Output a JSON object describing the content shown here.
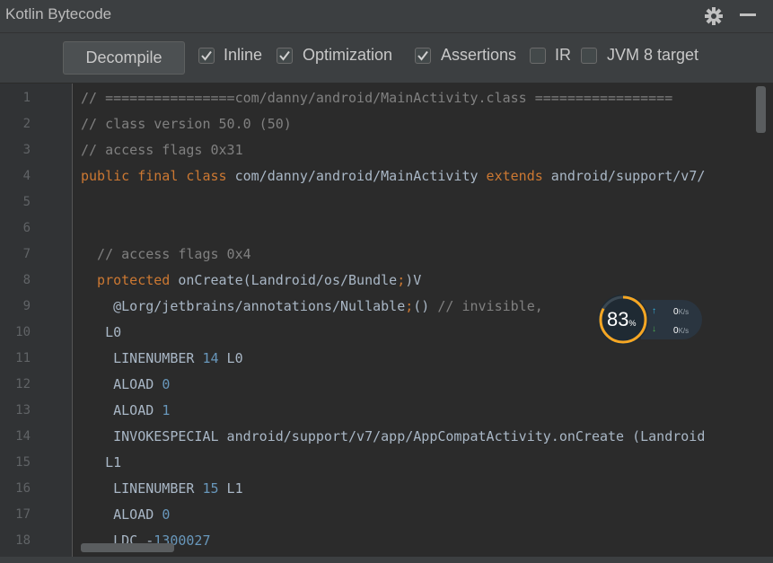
{
  "window": {
    "title": "Kotlin Bytecode"
  },
  "toolbar": {
    "decompile_label": "Decompile",
    "options": [
      {
        "label": "Inline",
        "checked": true
      },
      {
        "label": "Optimization",
        "checked": true
      },
      {
        "label": "Assertions",
        "checked": true
      },
      {
        "label": "IR",
        "checked": false
      },
      {
        "label": "JVM 8 target",
        "checked": false
      }
    ]
  },
  "editor": {
    "lines": [
      [
        {
          "t": "// ================com/danny/android/MainActivity.class =================",
          "c": "c"
        }
      ],
      [
        {
          "t": "// class version 50.0 (50)",
          "c": "c"
        }
      ],
      [
        {
          "t": "// access flags 0x31",
          "c": "c"
        }
      ],
      [
        {
          "t": "public final class",
          "c": "k"
        },
        {
          "t": " com/danny/android/MainActivity ",
          "c": ""
        },
        {
          "t": "extends",
          "c": "k"
        },
        {
          "t": " android/support/v7/",
          "c": ""
        }
      ],
      [],
      [],
      [
        {
          "t": "  // access flags 0x4",
          "c": "c"
        }
      ],
      [
        {
          "t": "  protected",
          "c": "k"
        },
        {
          "t": " onCreate(Landroid/os/Bundle",
          "c": ""
        },
        {
          "t": ";",
          "c": "k"
        },
        {
          "t": ")V",
          "c": ""
        }
      ],
      [
        {
          "t": "    @Lorg/jetbrains/annotations/Nullable",
          "c": ""
        },
        {
          "t": ";",
          "c": "k"
        },
        {
          "t": "() ",
          "c": ""
        },
        {
          "t": "// invisible, ",
          "c": "c"
        }
      ],
      [
        {
          "t": "   L0",
          "c": ""
        }
      ],
      [
        {
          "t": "    LINENUMBER ",
          "c": ""
        },
        {
          "t": "14",
          "c": "n"
        },
        {
          "t": " L0",
          "c": ""
        }
      ],
      [
        {
          "t": "    ALOAD ",
          "c": ""
        },
        {
          "t": "0",
          "c": "n"
        }
      ],
      [
        {
          "t": "    ALOAD ",
          "c": ""
        },
        {
          "t": "1",
          "c": "n"
        }
      ],
      [
        {
          "t": "    INVOKESPECIAL android/support/v7/app/AppCompatActivity.onCreate (Landroid",
          "c": ""
        }
      ],
      [
        {
          "t": "   L1",
          "c": ""
        }
      ],
      [
        {
          "t": "    LINENUMBER ",
          "c": ""
        },
        {
          "t": "15",
          "c": "n"
        },
        {
          "t": " L1",
          "c": ""
        }
      ],
      [
        {
          "t": "    ALOAD ",
          "c": ""
        },
        {
          "t": "0",
          "c": "n"
        }
      ],
      [
        {
          "t": "    LDC -",
          "c": ""
        },
        {
          "t": "1300027",
          "c": "n"
        }
      ]
    ]
  },
  "overlay": {
    "percent": "83",
    "percent_unit": "%",
    "upload": "0",
    "download": "0",
    "unit": "K/s"
  }
}
